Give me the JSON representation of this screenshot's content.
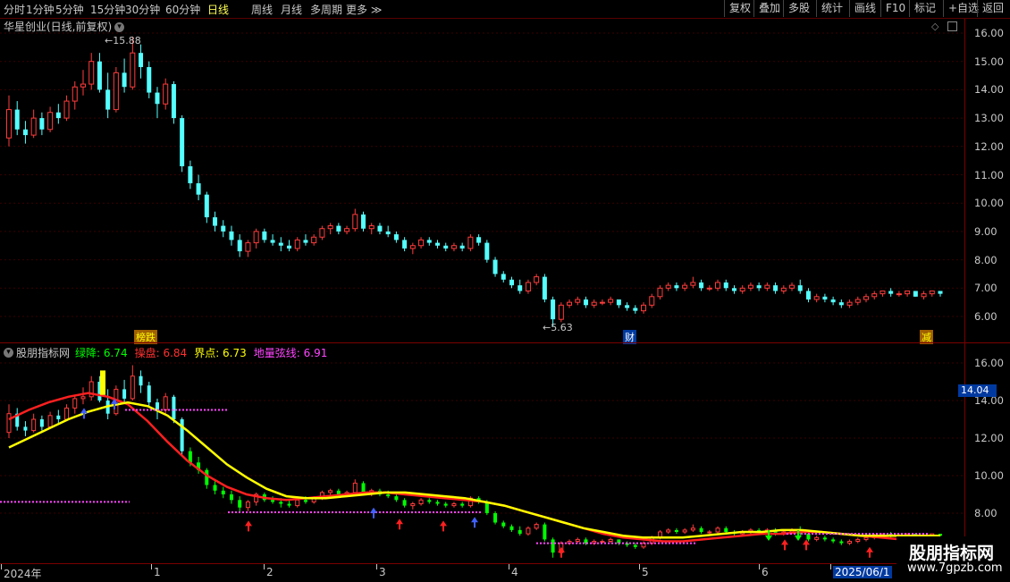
{
  "toolbar": {
    "periods": [
      "分时",
      "1分钟",
      "5分钟",
      "15分钟",
      "30分钟",
      "60分钟",
      "日线",
      "周线",
      "月线",
      "多周期",
      "更多"
    ],
    "active_period": "日线",
    "right_buttons": [
      "复权",
      "叠加",
      "多股",
      "统计",
      "画线",
      "F10",
      "标记",
      "+自选",
      "返回"
    ]
  },
  "main_panel": {
    "title": "华星创业(日线,前复权)",
    "high_label": "15.88",
    "low_label": "5.63",
    "event_labels": [
      "榜跌",
      "财",
      "减"
    ],
    "y_ticks": [
      "16.00",
      "15.00",
      "14.00",
      "13.00",
      "12.00",
      "11.00",
      "10.00",
      "9.00",
      "8.00",
      "7.00",
      "6.00"
    ]
  },
  "indicator_panel": {
    "name": "股朋指标网",
    "items": [
      {
        "label": "绿降:",
        "value": "6.74",
        "color": "#00ff00"
      },
      {
        "label": "操盘:",
        "value": "6.84",
        "color": "#ff3030"
      },
      {
        "label": "界点:",
        "value": "6.73",
        "color": "#ffff00"
      },
      {
        "label": "地量弦线:",
        "value": "6.91",
        "color": "#ff44ff"
      }
    ],
    "y_ticks": [
      "16.00",
      "14.00",
      "12.00",
      "10.00",
      "8.00"
    ],
    "price_box": "14.04"
  },
  "x_axis": {
    "labels": [
      "2024年",
      "1",
      "2",
      "3",
      "4",
      "5",
      "6",
      "2025/06/1"
    ]
  },
  "watermark": {
    "title": "股朋指标网",
    "url": "www.7gpzb.com"
  },
  "colors": {
    "up": "#ff3c3c",
    "down": "#54ffff",
    "bg": "#000000",
    "grid": "#3a0000"
  },
  "chart_data": {
    "type": "candlestick",
    "ylim": [
      5.5,
      16.5
    ],
    "ohlc": [
      [
        12.3,
        13.8,
        12.0,
        13.3
      ],
      [
        13.3,
        13.6,
        12.4,
        12.6
      ],
      [
        12.6,
        12.9,
        12.1,
        12.4
      ],
      [
        12.4,
        13.3,
        12.3,
        13.0
      ],
      [
        13.0,
        13.2,
        12.4,
        12.6
      ],
      [
        12.6,
        13.4,
        12.5,
        13.2
      ],
      [
        13.2,
        13.5,
        12.8,
        13.0
      ],
      [
        13.0,
        13.8,
        12.9,
        13.6
      ],
      [
        13.6,
        14.3,
        13.3,
        14.1
      ],
      [
        14.1,
        14.7,
        13.8,
        14.2
      ],
      [
        14.2,
        15.3,
        14.0,
        15.0
      ],
      [
        15.0,
        15.3,
        13.9,
        14.0
      ],
      [
        14.0,
        14.6,
        13.0,
        13.3
      ],
      [
        13.3,
        14.8,
        13.2,
        14.6
      ],
      [
        14.6,
        15.1,
        13.9,
        14.1
      ],
      [
        14.1,
        15.88,
        14.0,
        15.3
      ],
      [
        15.3,
        15.6,
        14.4,
        14.8
      ],
      [
        14.8,
        15.0,
        13.7,
        13.9
      ],
      [
        13.9,
        14.1,
        13.0,
        13.5
      ],
      [
        13.5,
        14.4,
        13.3,
        14.2
      ],
      [
        14.2,
        14.3,
        12.8,
        13.0
      ],
      [
        13.0,
        13.1,
        11.1,
        11.3
      ],
      [
        11.3,
        11.5,
        10.5,
        10.7
      ],
      [
        10.7,
        11.0,
        10.1,
        10.3
      ],
      [
        10.3,
        10.4,
        9.3,
        9.5
      ],
      [
        9.5,
        9.7,
        9.0,
        9.2
      ],
      [
        9.2,
        9.4,
        8.8,
        9.0
      ],
      [
        9.0,
        9.2,
        8.5,
        8.7
      ],
      [
        8.7,
        8.9,
        8.1,
        8.3
      ],
      [
        8.3,
        8.7,
        8.1,
        8.6
      ],
      [
        8.6,
        9.1,
        8.4,
        9.0
      ],
      [
        9.0,
        9.1,
        8.6,
        8.7
      ],
      [
        8.7,
        8.9,
        8.5,
        8.6
      ],
      [
        8.6,
        8.8,
        8.3,
        8.5
      ],
      [
        8.5,
        8.7,
        8.3,
        8.4
      ],
      [
        8.4,
        8.8,
        8.3,
        8.7
      ],
      [
        8.7,
        8.9,
        8.5,
        8.6
      ],
      [
        8.6,
        8.9,
        8.5,
        8.8
      ],
      [
        8.8,
        9.2,
        8.7,
        9.1
      ],
      [
        9.1,
        9.3,
        8.9,
        9.2
      ],
      [
        9.2,
        9.3,
        8.9,
        9.0
      ],
      [
        9.0,
        9.2,
        8.9,
        9.1
      ],
      [
        9.1,
        9.8,
        9.0,
        9.6
      ],
      [
        9.6,
        9.7,
        9.0,
        9.1
      ],
      [
        9.1,
        9.3,
        8.9,
        9.2
      ],
      [
        9.2,
        9.3,
        8.9,
        9.0
      ],
      [
        9.0,
        9.2,
        8.8,
        8.9
      ],
      [
        8.9,
        9.0,
        8.6,
        8.7
      ],
      [
        8.7,
        8.8,
        8.3,
        8.4
      ],
      [
        8.4,
        8.6,
        8.2,
        8.5
      ],
      [
        8.5,
        8.8,
        8.4,
        8.7
      ],
      [
        8.7,
        8.8,
        8.5,
        8.6
      ],
      [
        8.6,
        8.7,
        8.4,
        8.5
      ],
      [
        8.5,
        8.6,
        8.3,
        8.4
      ],
      [
        8.4,
        8.6,
        8.3,
        8.5
      ],
      [
        8.5,
        8.6,
        8.3,
        8.4
      ],
      [
        8.4,
        8.9,
        8.3,
        8.8
      ],
      [
        8.8,
        8.9,
        8.5,
        8.6
      ],
      [
        8.6,
        8.7,
        7.9,
        8.0
      ],
      [
        8.0,
        8.1,
        7.4,
        7.5
      ],
      [
        7.5,
        7.6,
        7.2,
        7.3
      ],
      [
        7.3,
        7.4,
        7.0,
        7.1
      ],
      [
        7.1,
        7.3,
        6.8,
        6.9
      ],
      [
        6.9,
        7.3,
        6.8,
        7.2
      ],
      [
        7.2,
        7.5,
        7.1,
        7.4
      ],
      [
        7.4,
        7.5,
        6.5,
        6.6
      ],
      [
        6.6,
        6.7,
        5.63,
        5.9
      ],
      [
        5.9,
        6.5,
        5.8,
        6.4
      ],
      [
        6.4,
        6.6,
        6.3,
        6.5
      ],
      [
        6.5,
        6.7,
        6.4,
        6.6
      ],
      [
        6.6,
        6.7,
        6.3,
        6.4
      ],
      [
        6.4,
        6.6,
        6.3,
        6.5
      ],
      [
        6.5,
        6.6,
        6.4,
        6.5
      ],
      [
        6.5,
        6.7,
        6.4,
        6.6
      ],
      [
        6.6,
        6.6,
        6.3,
        6.4
      ],
      [
        6.4,
        6.5,
        6.2,
        6.3
      ],
      [
        6.3,
        6.4,
        6.1,
        6.2
      ],
      [
        6.2,
        6.5,
        6.1,
        6.4
      ],
      [
        6.4,
        6.8,
        6.3,
        6.7
      ],
      [
        6.7,
        7.1,
        6.6,
        7.0
      ],
      [
        7.0,
        7.2,
        6.9,
        7.1
      ],
      [
        7.1,
        7.2,
        6.9,
        7.0
      ],
      [
        7.0,
        7.2,
        6.9,
        7.1
      ],
      [
        7.1,
        7.4,
        7.0,
        7.2
      ],
      [
        7.2,
        7.3,
        6.9,
        7.0
      ],
      [
        7.0,
        7.1,
        6.9,
        7.0
      ],
      [
        7.0,
        7.3,
        6.9,
        7.2
      ],
      [
        7.2,
        7.3,
        6.9,
        7.0
      ],
      [
        7.0,
        7.1,
        6.8,
        6.9
      ],
      [
        6.9,
        7.1,
        6.8,
        7.0
      ],
      [
        7.0,
        7.2,
        6.9,
        7.1
      ],
      [
        7.1,
        7.2,
        6.9,
        7.0
      ],
      [
        7.0,
        7.2,
        6.9,
        7.1
      ],
      [
        7.1,
        7.2,
        6.8,
        6.9
      ],
      [
        6.9,
        7.1,
        6.8,
        7.0
      ],
      [
        7.0,
        7.2,
        6.9,
        7.1
      ],
      [
        7.1,
        7.3,
        6.8,
        6.9
      ],
      [
        6.9,
        7.0,
        6.5,
        6.6
      ],
      [
        6.6,
        6.8,
        6.5,
        6.7
      ],
      [
        6.7,
        6.8,
        6.5,
        6.6
      ],
      [
        6.6,
        6.7,
        6.4,
        6.5
      ],
      [
        6.5,
        6.6,
        6.3,
        6.4
      ],
      [
        6.4,
        6.6,
        6.3,
        6.5
      ],
      [
        6.5,
        6.7,
        6.4,
        6.6
      ],
      [
        6.6,
        6.8,
        6.5,
        6.7
      ],
      [
        6.7,
        6.9,
        6.6,
        6.8
      ],
      [
        6.8,
        6.9,
        6.7,
        6.9
      ],
      [
        6.9,
        7.0,
        6.7,
        6.8
      ],
      [
        6.8,
        6.9,
        6.7,
        6.8
      ],
      [
        6.8,
        6.9,
        6.7,
        6.9
      ],
      [
        6.9,
        6.9,
        6.7,
        6.7
      ],
      [
        6.7,
        6.9,
        6.6,
        6.8
      ],
      [
        6.8,
        6.9,
        6.7,
        6.9
      ],
      [
        6.9,
        6.9,
        6.7,
        6.8
      ]
    ],
    "indicator_lines": {
      "操盘": [
        13.0,
        13.5,
        13.9,
        14.2,
        14.4,
        14.2,
        13.8,
        12.9,
        11.8,
        10.8,
        10.0,
        9.4,
        9.0,
        8.8,
        8.7,
        8.8,
        8.9,
        9.0,
        9.1,
        9.1,
        9.0,
        8.9,
        8.8,
        8.7,
        8.6,
        8.4,
        8.1,
        7.8,
        7.5,
        7.2,
        6.9,
        6.7,
        6.6,
        6.5,
        6.5,
        6.6,
        6.7,
        6.8,
        6.9,
        6.9,
        7.0,
        7.0,
        6.9,
        6.8,
        6.7,
        6.6,
        6.7,
        6.8
      ],
      "界点": [
        11.5,
        12.0,
        12.5,
        13.0,
        13.4,
        13.7,
        13.9,
        13.7,
        13.2,
        12.4,
        11.5,
        10.6,
        9.9,
        9.3,
        8.9,
        8.8,
        8.8,
        8.9,
        9.0,
        9.1,
        9.1,
        9.0,
        8.9,
        8.8,
        8.6,
        8.4,
        8.1,
        7.8,
        7.5,
        7.2,
        7.0,
        6.8,
        6.7,
        6.7,
        6.7,
        6.8,
        6.9,
        7.0,
        7.0,
        7.1,
        7.1,
        7.0,
        6.9,
        6.8,
        6.8,
        6.8,
        6.8,
        6.8
      ]
    }
  }
}
